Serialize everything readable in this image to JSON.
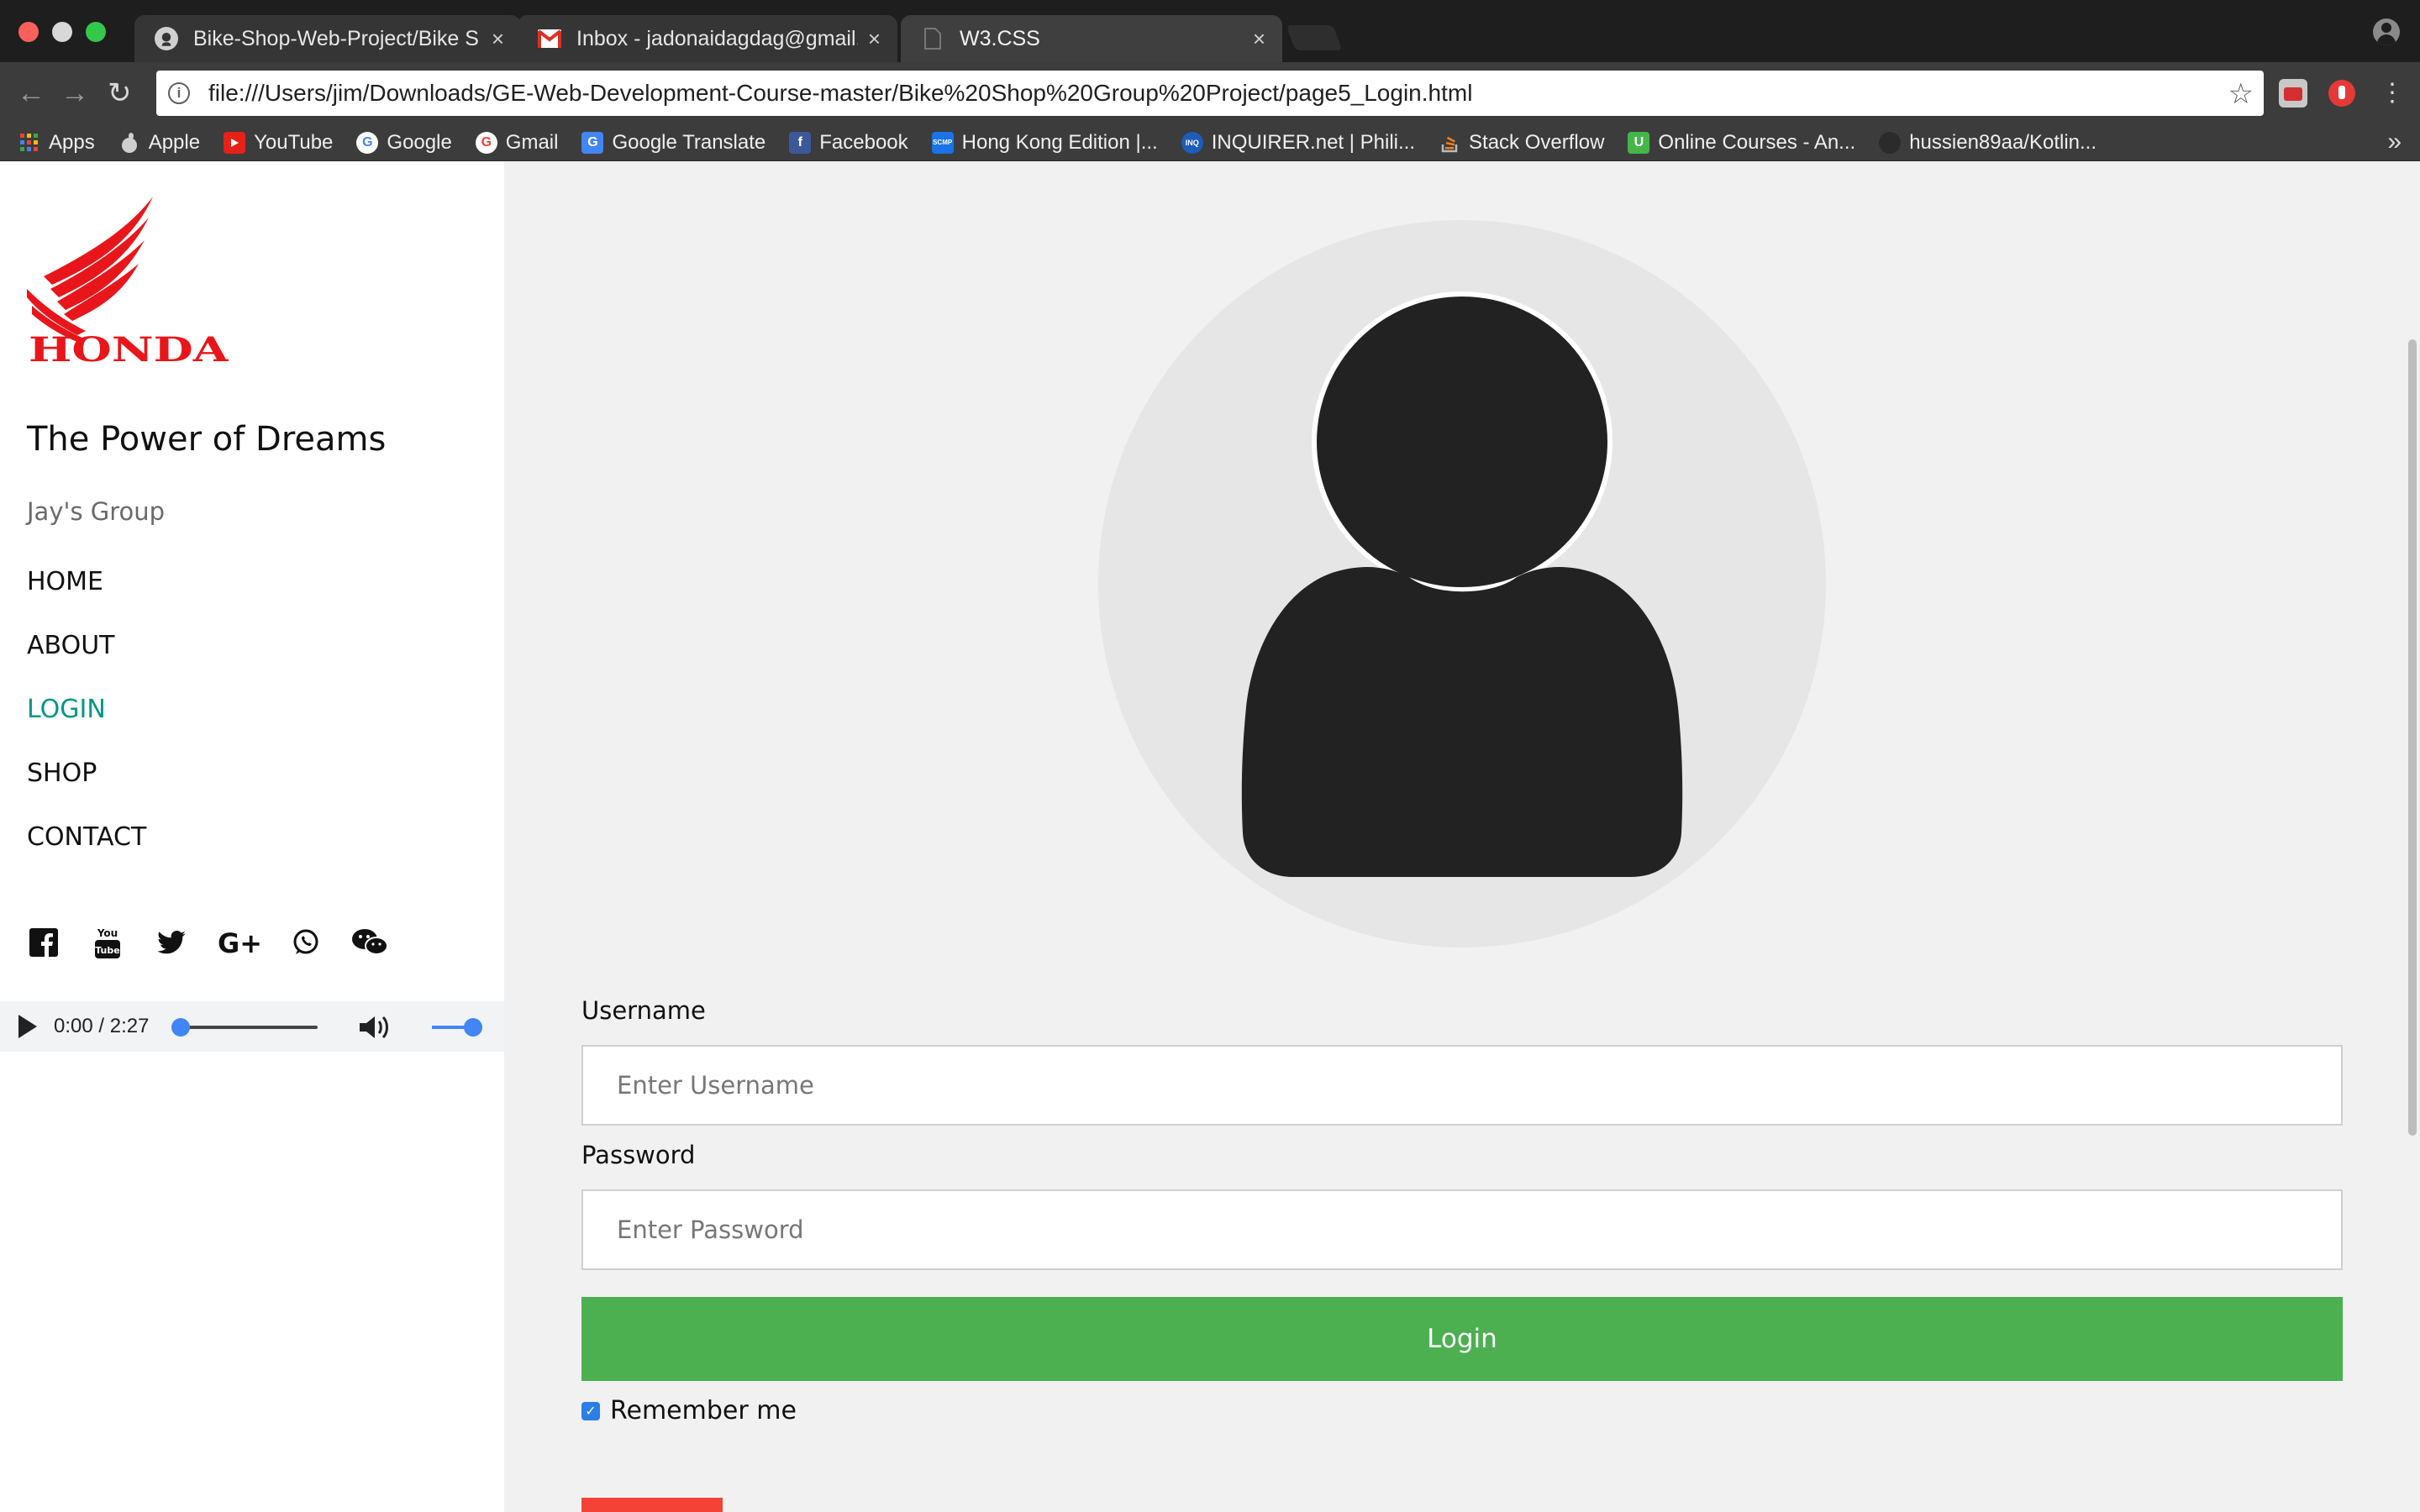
{
  "browser": {
    "tabs": [
      {
        "title": "Bike-Shop-Web-Project/Bike S",
        "icon": "github-icon",
        "active": false
      },
      {
        "title": "Inbox - jadonaidagdag@gmail.c",
        "icon": "gmail-icon",
        "active": false
      },
      {
        "title": "W3.CSS",
        "icon": "document-icon",
        "active": true
      }
    ],
    "close_glyph": "×",
    "url": "file:///Users/jim/Downloads/GE-Web-Development-Course-master/Bike%20Shop%20Group%20Project/page5_Login.html",
    "bookmarks": [
      {
        "label": "Apps",
        "icon": "apps-grid-icon"
      },
      {
        "label": "Apple",
        "icon": "apple-icon"
      },
      {
        "label": "YouTube",
        "icon": "youtube-icon"
      },
      {
        "label": "Google",
        "icon": "google-icon"
      },
      {
        "label": "Gmail",
        "icon": "google-icon"
      },
      {
        "label": "Google Translate",
        "icon": "translate-icon"
      },
      {
        "label": "Facebook",
        "icon": "facebook-icon"
      },
      {
        "label": "Hong Kong Edition |...",
        "icon": "scmp-icon"
      },
      {
        "label": "INQUIRER.net | Phili...",
        "icon": "inquirer-icon"
      },
      {
        "label": "Stack Overflow",
        "icon": "stackoverflow-icon"
      },
      {
        "label": "Online Courses - An...",
        "icon": "udemy-icon"
      },
      {
        "label": "hussien89aa/Kotlin...",
        "icon": "github-icon"
      }
    ],
    "bookmarks_overflow": "»"
  },
  "sidebar": {
    "logo_text": "HONDA",
    "slogan": "The Power of Dreams",
    "group": "Jay's Group",
    "nav": [
      {
        "label": "HOME",
        "active": false
      },
      {
        "label": "ABOUT",
        "active": false
      },
      {
        "label": "LOGIN",
        "active": true
      },
      {
        "label": "SHOP",
        "active": false
      },
      {
        "label": "CONTACT",
        "active": false
      }
    ],
    "social_icons": [
      "facebook-icon",
      "youtube-icon",
      "twitter-icon",
      "google-plus-icon",
      "whatsapp-icon",
      "wechat-icon"
    ],
    "audio": {
      "time": "0:00 / 2:27",
      "progress": 0,
      "volume": 1
    }
  },
  "login": {
    "username_label": "Username",
    "username_placeholder": "Enter Username",
    "password_label": "Password",
    "password_placeholder": "Enter Password",
    "login_button": "Login",
    "remember_label": "Remember me",
    "remember_checked": true
  },
  "colors": {
    "honda_red": "#e8161b",
    "active_nav": "#009688",
    "login_green": "#4caf50",
    "cancel_red": "#f44336",
    "avatar_bg": "#e6e6e6",
    "avatar_fg": "#222222"
  }
}
